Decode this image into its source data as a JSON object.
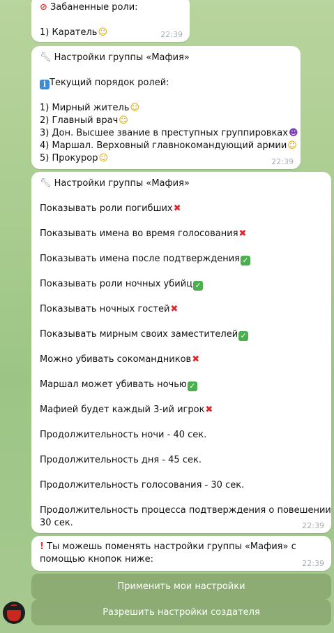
{
  "messages": {
    "banned": {
      "title": "Забаненные роли:",
      "items": [
        "1) Каратель"
      ],
      "time": "22:39"
    },
    "order": {
      "title": "Настройки группы «Мафия»",
      "subtitle": "Текущий порядок ролей:",
      "items": [
        "1) Мирный житель",
        "2) Главный врач",
        "3) Дон. Высшее звание в преступных группировках",
        "4) Маршал. Верховный главнокомандующий армии",
        "5) Прокурор"
      ],
      "time": "22:39"
    },
    "settings": {
      "title": "Настройки группы «Мафия»",
      "items": [
        "Показывать роли погибших",
        "Показывать имена во время голосования",
        "Показывать имена после подтверждения",
        "Показывать роли ночных убийц",
        "Показывать ночных гостей",
        "Показывать мирным своих заместителей",
        "Можно убивать сокомандников",
        "Маршал может убивать ночью",
        "Мафией будет каждый 3-ий игрок",
        "Продолжительность ночи - 40 сек.",
        "Продолжительность дня - 45 сек.",
        "Продолжительность голосования - 30 сек.",
        "Продолжительность процесса подтверждения о повешении -",
        "30 сек."
      ],
      "time": "22:39"
    },
    "prompt": {
      "line1": "Ты можешь поменять настройки группы «Мафия» с",
      "line2": "помощью кнопок ниже:",
      "time": "22:39"
    }
  },
  "buttons": {
    "apply": "Применить мои настройки",
    "allow": "Разрешить настройки создателя"
  },
  "icons": {
    "ban": "no-entry-icon",
    "wrench": "wrench-icon",
    "info": "info-icon",
    "smile": "slightly-smiling-face-icon",
    "devil": "smiling-imp-icon",
    "enabled": "check-mark-button-icon",
    "disabled": "cross-mark-icon",
    "alert": "exclamation-mark-icon"
  },
  "colors": {
    "check": "#4cae4f",
    "cross": "#e2262c",
    "button_bg": "#7f9a66"
  }
}
